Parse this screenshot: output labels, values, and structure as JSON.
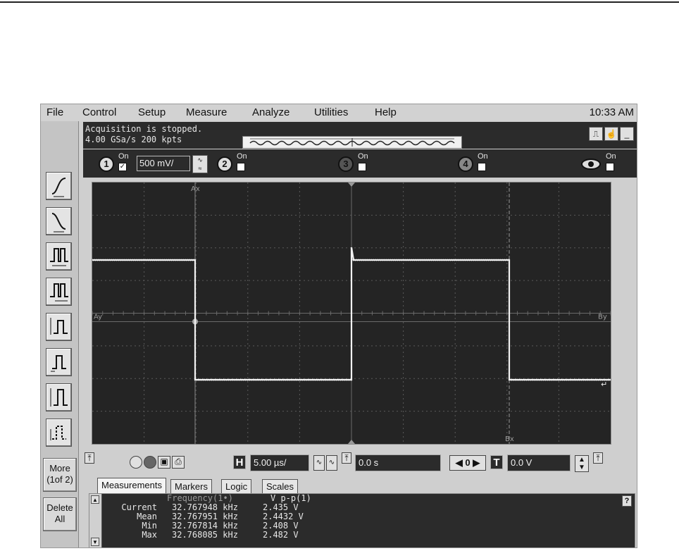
{
  "menu": [
    "File",
    "Control",
    "Setup",
    "Measure",
    "Analyze",
    "Utilities",
    "Help"
  ],
  "clock": "10:33 AM",
  "status": {
    "line1": "Acquisition is stopped.",
    "line2": "4.00 GSa/s  200 kpts"
  },
  "channels": {
    "on_label": "On",
    "ch1_number": "1",
    "ch1_scale": "500 mV/",
    "ch2_number": "2",
    "ch3_number": "3",
    "ch4_number": "4"
  },
  "left_toolbar": {
    "more_label": "More\n(1of 2)",
    "delete_label": "Delete\nAll"
  },
  "controls": {
    "timebase": "5.00 µs/",
    "delay": "0.0 s",
    "trigger_level": "0.0 V",
    "h_icon": "H",
    "t_icon": "T"
  },
  "markers": {
    "ax": "Ax",
    "ay": "Ay",
    "bx": "Bx",
    "by": "By"
  },
  "tabs": [
    "Measurements",
    "Markers",
    "Logic",
    "Scales"
  ],
  "measurements": {
    "col1_header": "Frequency(1•)",
    "col2_header": "V p-p(1)",
    "rows": [
      {
        "label": "Current",
        "freq": "32.767948 kHz",
        "vpp": "2.435 V"
      },
      {
        "label": "Mean",
        "freq": "32.767951 kHz",
        "vpp": "2.4432 V"
      },
      {
        "label": "Min",
        "freq": "32.767814 kHz",
        "vpp": "2.408 V"
      },
      {
        "label": "Max",
        "freq": "32.768085 kHz",
        "vpp": "2.482 V"
      }
    ],
    "help": "?"
  },
  "colors": {
    "screen_bg": "#242424",
    "trace": "#f2f2f2",
    "grid": "#5a5a5a"
  }
}
